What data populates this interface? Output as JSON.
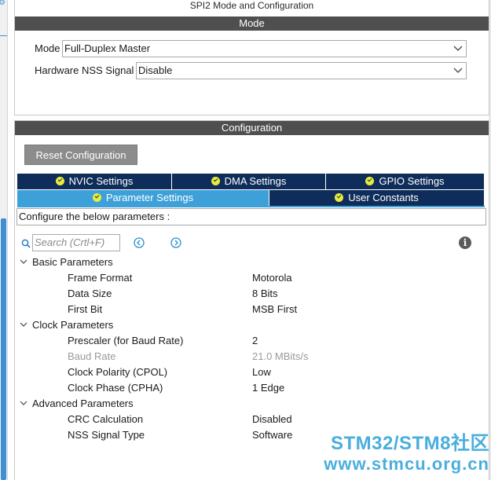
{
  "window_title": "SPI2 Mode and Configuration",
  "mode_section": {
    "header": "Mode",
    "mode_label": "Mode",
    "mode_value": "Full-Duplex Master",
    "nss_label": "Hardware NSS Signal",
    "nss_value": "Disable"
  },
  "config_section": {
    "header": "Configuration",
    "reset_button": "Reset Configuration",
    "tabs": [
      {
        "label": "NVIC Settings"
      },
      {
        "label": "DMA Settings"
      },
      {
        "label": "GPIO Settings"
      },
      {
        "label": "Parameter Settings"
      },
      {
        "label": "User Constants"
      }
    ],
    "description": "Configure the below parameters :",
    "search_placeholder": "Search (Crtl+F)",
    "info_glyph": "i",
    "groups": [
      {
        "name": "Basic Parameters",
        "params": [
          {
            "name": "Frame Format",
            "value": "Motorola"
          },
          {
            "name": "Data Size",
            "value": "8 Bits"
          },
          {
            "name": "First Bit",
            "value": "MSB First"
          }
        ]
      },
      {
        "name": "Clock Parameters",
        "params": [
          {
            "name": "Prescaler (for Baud Rate)",
            "value": "2"
          },
          {
            "name": "Baud Rate",
            "value": "21.0 MBits/s"
          },
          {
            "name": "Clock Polarity (CPOL)",
            "value": "Low"
          },
          {
            "name": "Clock Phase (CPHA)",
            "value": "1 Edge"
          }
        ]
      },
      {
        "name": "Advanced Parameters",
        "params": [
          {
            "name": "CRC Calculation",
            "value": "Disabled"
          },
          {
            "name": "NSS Signal Type",
            "value": "Software"
          }
        ]
      }
    ]
  },
  "watermark": {
    "line1": "STM32/STM8社区",
    "line2": "www.stmcu.org.cn"
  },
  "colors": {
    "section_bar": "#4f4f4f",
    "tab_inactive": "#0f2d5a",
    "tab_active": "#3ea0d8",
    "check_icon": "#e9ec3c",
    "watermark": "#2aa0d8"
  },
  "icons": {
    "search": "search-icon",
    "prev": "circle-chevron-left-icon",
    "next": "circle-chevron-right-icon",
    "info": "info-icon",
    "check": "check-circle-icon",
    "chevron": "chevron-down-icon",
    "caret": "caret-down-icon",
    "gear": "gear-icon"
  }
}
